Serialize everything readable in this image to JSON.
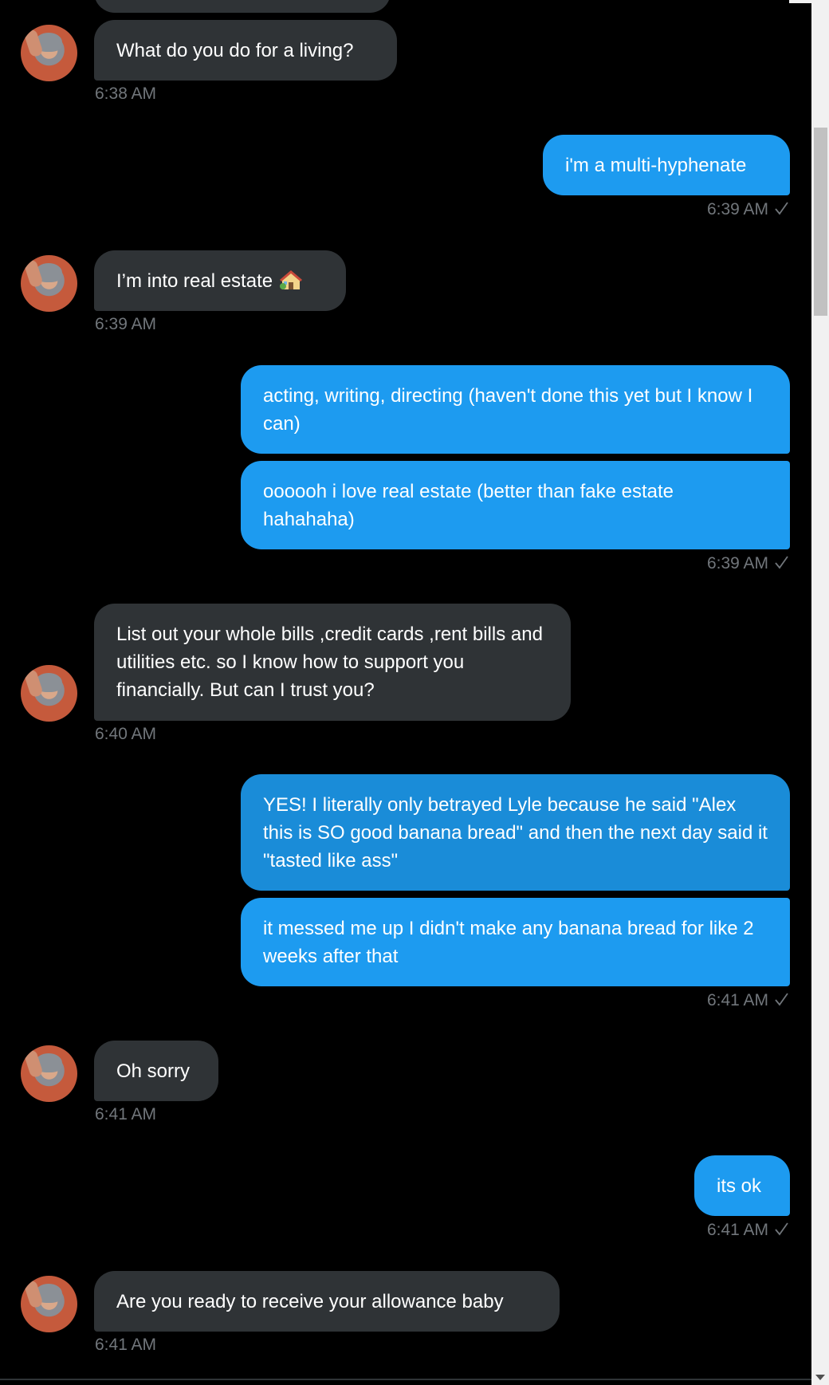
{
  "messages": [
    {
      "sender": "them",
      "text": "What do you do for a living?",
      "time": "6:38 AM"
    },
    {
      "sender": "me",
      "text": "i'm a multi-hyphenate",
      "time": "6:39 AM"
    },
    {
      "sender": "them",
      "text": "I’m into real estate",
      "emoji": "house-icon",
      "time": "6:39 AM"
    },
    {
      "sender": "me",
      "text": "acting, writing, directing (haven't done this yet but I know I can)"
    },
    {
      "sender": "me",
      "text": "oooooh i love real estate (better than fake estate hahahaha)",
      "time": "6:39 AM"
    },
    {
      "sender": "them",
      "text": "List out your whole bills ,credit cards ,rent bills and utilities etc. so I know how to support you financially. But can I trust you?",
      "time": "6:40 AM"
    },
    {
      "sender": "me",
      "text": "YES! I literally only betrayed Lyle because he said \"Alex this is SO good banana bread\" and then the next day said it \"tasted like ass\""
    },
    {
      "sender": "me",
      "text": "it messed me up I didn't make any banana bread for like 2 weeks after that",
      "time": "6:41 AM"
    },
    {
      "sender": "them",
      "text": "Oh sorry",
      "time": "6:41 AM"
    },
    {
      "sender": "me",
      "text": "its ok",
      "time": "6:41 AM"
    },
    {
      "sender": "them",
      "text": "Are you ready to receive your allowance baby",
      "time": "6:41 AM"
    }
  ],
  "colors": {
    "sent_bubble": "#1d9bf0",
    "received_bubble": "#2f3336",
    "timestamp": "#71767b",
    "background": "#000000"
  }
}
